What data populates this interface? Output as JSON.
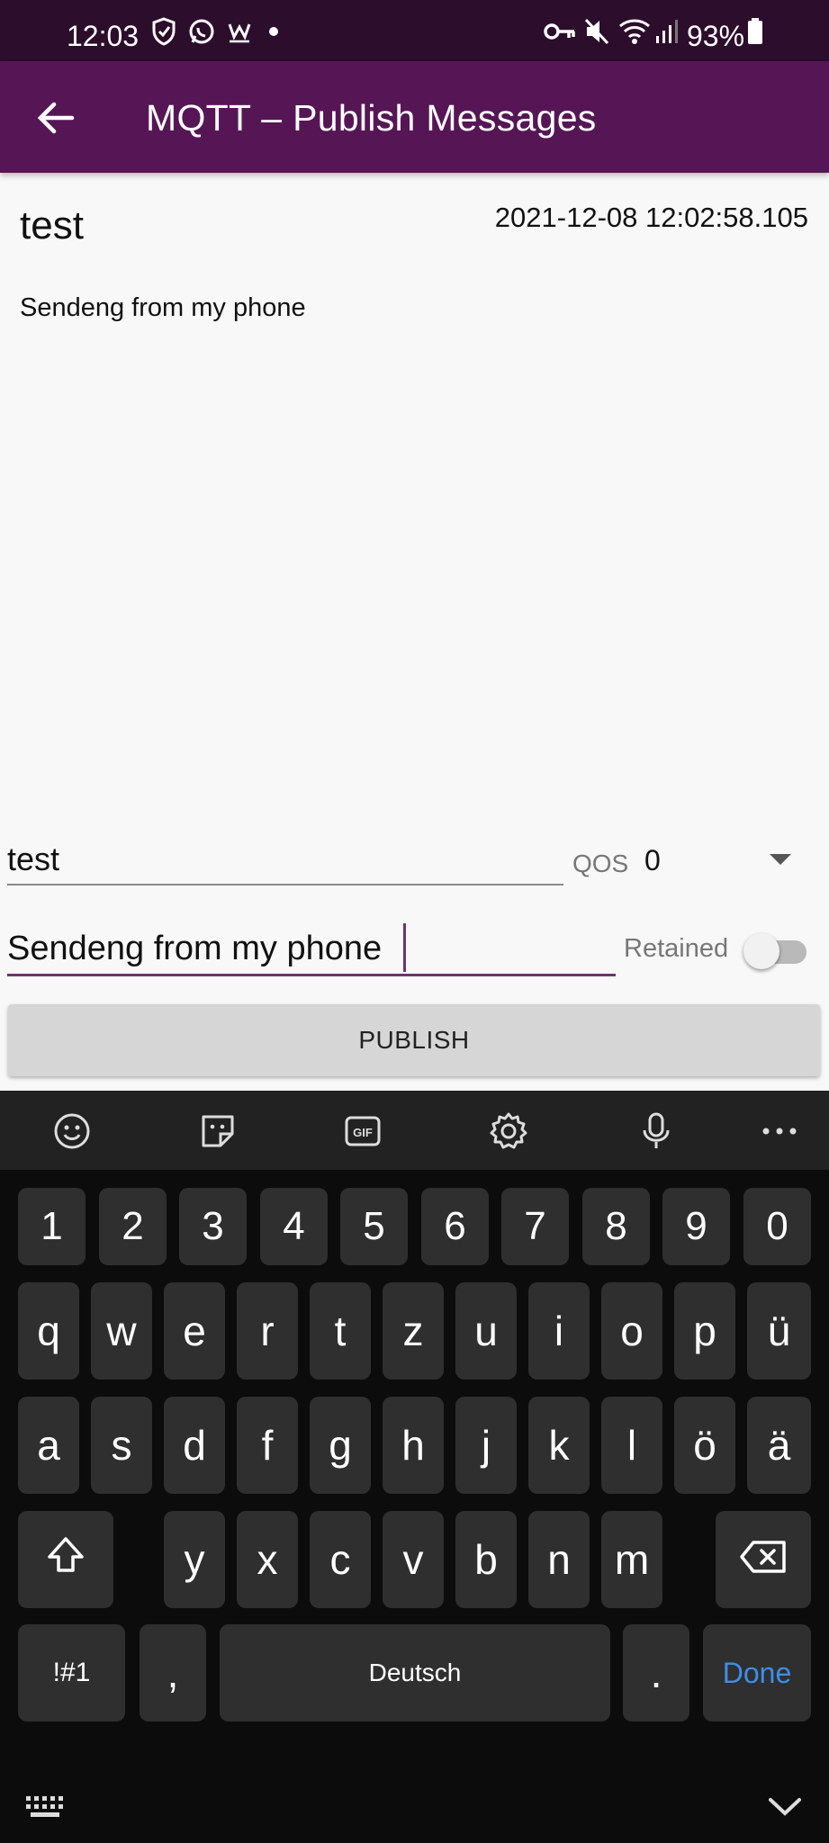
{
  "status_bar": {
    "time": "12:03",
    "battery": "93%",
    "icons": [
      "shield-icon",
      "whatsapp-icon",
      "w-icon",
      "dot-icon",
      "key-icon",
      "mute-icon",
      "wifi-icon",
      "signal-icon",
      "battery-icon"
    ]
  },
  "app_bar": {
    "title": "MQTT – Publish Messages",
    "back_icon": "arrow-back-icon",
    "color": "#561656"
  },
  "message": {
    "topic": "test",
    "timestamp": "2021-12-08 12:02:58.105",
    "body": "Sendeng from my phone"
  },
  "form": {
    "topic_value": "test",
    "qos_label": "QOS",
    "qos_value": "0",
    "message_value": "Sendeng from my phone",
    "retained_label": "Retained",
    "retained_on": false,
    "publish_label": "PUBLISH",
    "accent": "#6d3470"
  },
  "keyboard": {
    "toolbar_icons": [
      "emoji-icon",
      "sticker-icon",
      "gif-icon",
      "settings-icon",
      "mic-icon",
      "more-icon"
    ],
    "gif_label": "GIF",
    "number_row": [
      "1",
      "2",
      "3",
      "4",
      "5",
      "6",
      "7",
      "8",
      "9",
      "0"
    ],
    "row1": [
      "q",
      "w",
      "e",
      "r",
      "t",
      "z",
      "u",
      "i",
      "o",
      "p",
      "ü"
    ],
    "row2": [
      "a",
      "s",
      "d",
      "f",
      "g",
      "h",
      "j",
      "k",
      "l",
      "ö",
      "ä"
    ],
    "row3": [
      "y",
      "x",
      "c",
      "v",
      "b",
      "n",
      "m"
    ],
    "symbols_label": "!#1",
    "comma_label": ",",
    "space_label": "Deutsch",
    "period_label": ".",
    "done_label": "Done",
    "done_color": "#3d8fe8"
  }
}
